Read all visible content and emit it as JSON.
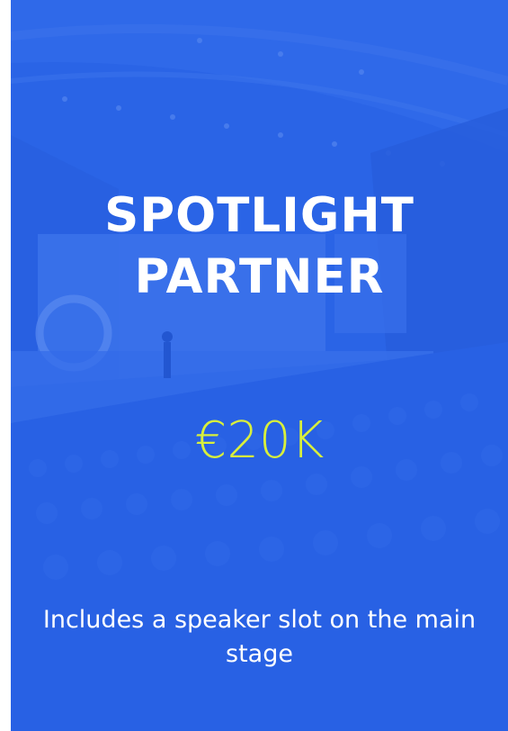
{
  "card": {
    "title_line1": "SPOTLIGHT",
    "title_line2": "PARTNER",
    "price": "€20K",
    "description": "Includes a speaker slot on the main stage",
    "background_image": "conference-auditorium-photo"
  },
  "colors": {
    "card_background": "#2c63e6",
    "price_text": "#d8ef3c",
    "title_text": "#ffffff"
  }
}
